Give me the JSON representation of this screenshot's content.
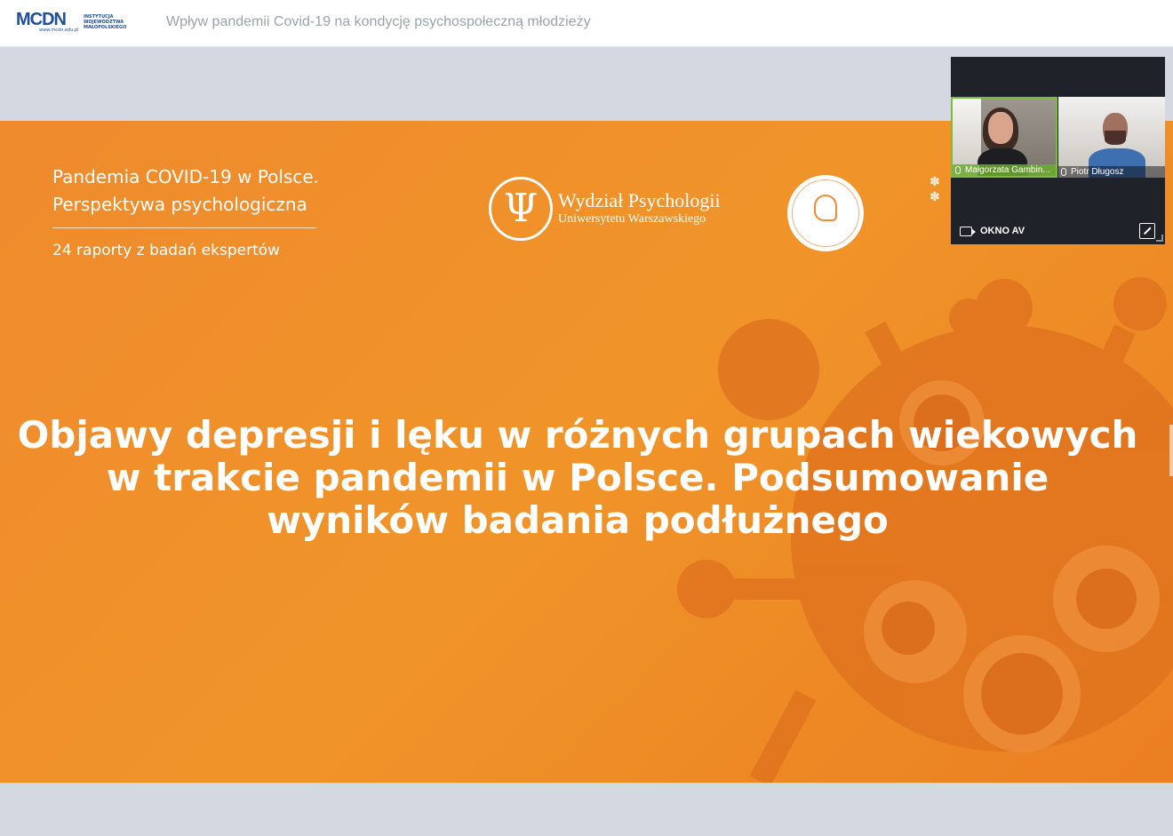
{
  "header": {
    "logo": {
      "mark": "MCDN",
      "url": "www.mcdn.edu.pl",
      "institution_lines": [
        "INSTYTUCJA",
        "WOJEWÓDZTWA",
        "MAŁOPOLSKIEGO"
      ]
    },
    "title": "Wpływ pandemii Covid-19 na kondycję psychospołeczną młodzieży"
  },
  "slide": {
    "series_line1": "Pandemia COVID-19 w Polsce.",
    "series_line2": "Perspektywa psychologiczna",
    "series_subtitle": "24 raporty z badań ekspertów",
    "faculty_logo": {
      "line1": "Wydział Psychologii",
      "line2": "Uniwersytetu Warszawskiego",
      "symbol": "Ψ"
    },
    "title_lines": [
      "Objawy depresji i lęku w różnych grupach wiekowych",
      "w trakcie pandemii w Polsce. Podsumowanie",
      "wyników badania podłużnego"
    ],
    "colors": {
      "background": "#ef8a2d",
      "text": "#ffffff",
      "virus": "#e0741f"
    }
  },
  "av_window": {
    "participants": [
      {
        "name": "Małgorzata Gambin..."
      },
      {
        "name": "Piotr Długosz"
      }
    ],
    "label": "OKNO AV",
    "icons": [
      "camera-icon",
      "expand-icon",
      "resize-handle-icon",
      "microphone-icon"
    ]
  }
}
